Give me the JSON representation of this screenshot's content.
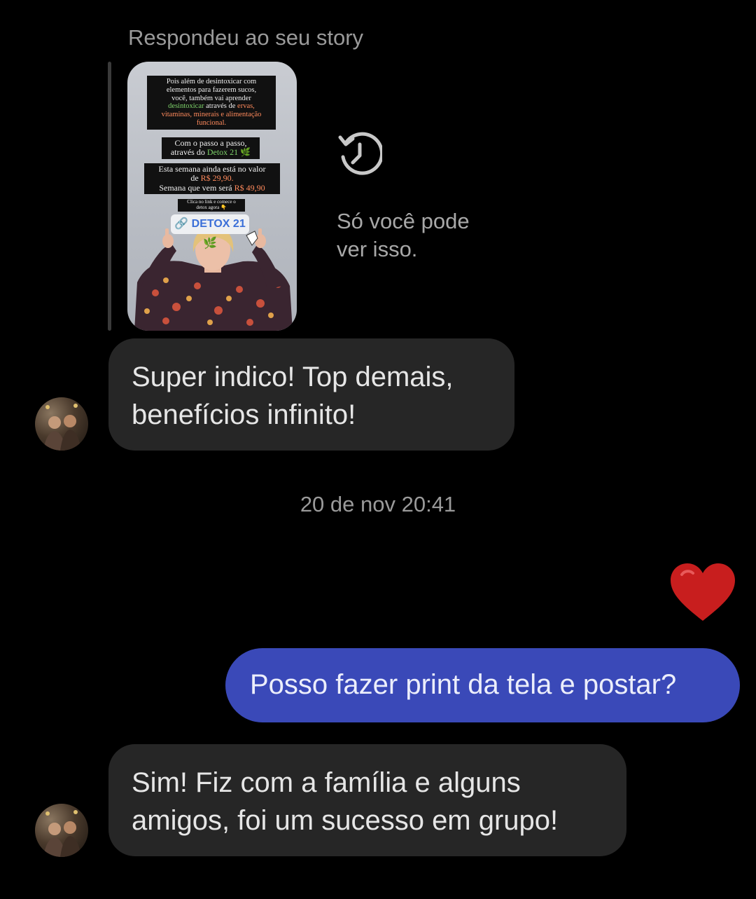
{
  "reply": {
    "header": "Respondeu ao seu story",
    "notice": "Só você pode ver isso."
  },
  "story": {
    "block1": {
      "line1": "Pois além de desintoxicar com",
      "line2": "elementos para fazerem sucos,",
      "line3": "você, também vai aprender",
      "highlight_green": "desintoxicar",
      "line4_rest": " através de ",
      "highlight_orange1": "ervas,",
      "line5": "vitaminas, minerais e alimentação",
      "line6": "funcional."
    },
    "block2": {
      "line1": "Com o passo a passo,",
      "line2": "através do ",
      "highlight_green": "Detox 21 🌿"
    },
    "block3": {
      "line1": "Esta semana ainda está no valor",
      "line2": "de ",
      "price_now": "R$ 29,90.",
      "line3": "Semana que vem será ",
      "price_next": "R$ 49,90"
    },
    "block4": {
      "line1": "Clica no link e comece o",
      "line2": "detox agora 👇"
    },
    "link_label": "DETOX 21 🌿",
    "link_icon": "link-icon"
  },
  "messages": [
    {
      "direction": "incoming",
      "text_line1": "Super indico! Top demais,",
      "text_line2": "benefícios infinito!"
    },
    {
      "direction": "outgoing",
      "text": "Posso fazer print da tela e postar?",
      "reaction": "heart-icon"
    },
    {
      "direction": "incoming",
      "text_line1": "Sim! Fiz com a família e alguns",
      "text_line2": "amigos, foi um sucesso em grupo!"
    }
  ],
  "timestamp": "20 de nov 20:41",
  "colors": {
    "background": "#000000",
    "incoming_bubble": "#262626",
    "outgoing_bubble": "#3a49b8",
    "heart": "#c81e1e"
  }
}
